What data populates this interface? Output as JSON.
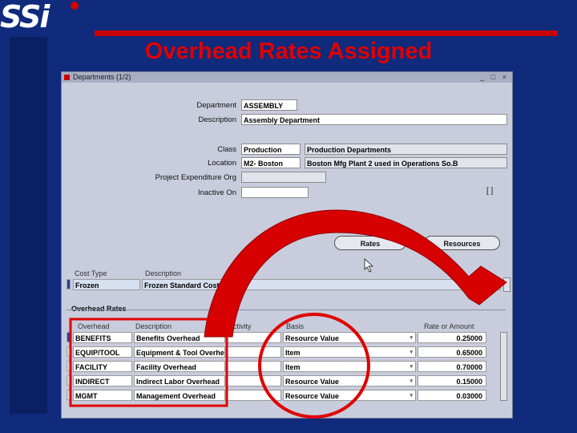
{
  "brand": {
    "logo_text": "SSi"
  },
  "slide": {
    "title": "Overhead Rates Assigned"
  },
  "window": {
    "title": "Departments (1/2)",
    "controls": "_ □ ×"
  },
  "form": {
    "department": {
      "label": "Department",
      "value": "ASSEMBLY"
    },
    "description": {
      "label": "Description",
      "value": "Assembly Department"
    },
    "class": {
      "label": "Class",
      "value": "Production",
      "desc": "Production Departments"
    },
    "location": {
      "label": "Location",
      "value": "M2- Boston",
      "desc": "Boston Mfg Plant 2 used in Operations So.B"
    },
    "project_org": {
      "label": "Project Expenditure Org",
      "value": ""
    },
    "inactive_on": {
      "label": "Inactive On",
      "value": ""
    },
    "dff": "[ ]"
  },
  "buttons": {
    "rates": "Rates",
    "resources": "Resources"
  },
  "cost_type": {
    "headers": {
      "cost_type": "Cost Type",
      "description": "Description"
    },
    "row": {
      "cost_type": "Frozen",
      "description": "Frozen Standard Cost Type"
    }
  },
  "overhead_rates": {
    "section_title": "Overhead Rates",
    "headers": {
      "overhead": "Overhead",
      "description": "Description",
      "activity": "Activity",
      "basis": "Basis",
      "rate": "Rate or Amount"
    },
    "rows": [
      {
        "overhead": "BENEFITS",
        "description": "Benefits Overhead",
        "activity": "",
        "basis": "Resource Value",
        "rate": "0.25000"
      },
      {
        "overhead": "EQUIP/TOOL",
        "description": "Equipment & Tool Overhead",
        "activity": "",
        "basis": "Item",
        "rate": "0.65000"
      },
      {
        "overhead": "FACILITY",
        "description": "Facility Overhead",
        "activity": "",
        "basis": "Item",
        "rate": "0.70000"
      },
      {
        "overhead": "INDIRECT",
        "description": "Indirect Labor Overhead",
        "activity": "",
        "basis": "Resource Value",
        "rate": "0.15000"
      },
      {
        "overhead": "MGMT",
        "description": "Management Overhead",
        "activity": "",
        "basis": "Resource Value",
        "rate": "0.03000"
      }
    ]
  },
  "colors": {
    "background": "#102a7c",
    "accent_red": "#e00000",
    "window": "#c8ccdc"
  }
}
